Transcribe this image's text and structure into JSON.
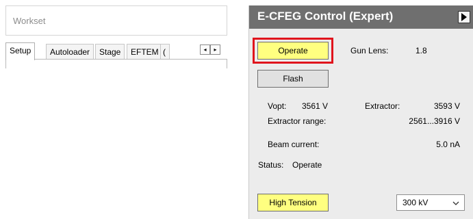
{
  "workset": {
    "title": "Workset",
    "tabs": [
      "Setup",
      "Autoloader",
      "Stage",
      "EFTEM",
      "("
    ],
    "scroll_left": "◂",
    "scroll_right": "▸"
  },
  "cfeg": {
    "title": "E-CFEG Control (Expert)",
    "operate_button": "Operate",
    "gun_lens_label": "Gun Lens:",
    "gun_lens_value": "1.8",
    "flash_button": "Flash",
    "vopt_label": "Vopt:",
    "vopt_value": "3561 V",
    "extractor_label": "Extractor:",
    "extractor_value": "3593 V",
    "extractor_range_label": "Extractor range:",
    "extractor_range_value": "2561...3916 V",
    "beam_current_label": "Beam current:",
    "beam_current_value": "5.0 nA",
    "status_label": "Status:",
    "status_value": "Operate",
    "high_tension_button": "High Tension",
    "high_tension_select": "300 kV"
  },
  "colors": {
    "highlight": "#e0141c",
    "button_active": "#ffff80",
    "header": "#6f6f6f"
  },
  "icons": [
    "expand-arrow-icon",
    "chevron-down-icon",
    "scroll-left-icon",
    "scroll-right-icon"
  ]
}
